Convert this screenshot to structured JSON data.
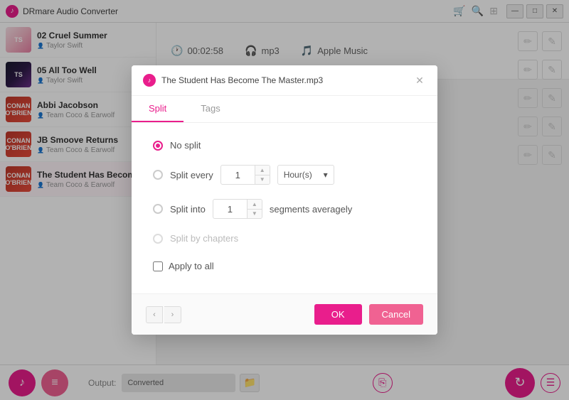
{
  "app": {
    "title": "DRmare Audio Converter",
    "icon": "♪"
  },
  "titlebar": {
    "toolbar_icons": [
      "🛒",
      "🔍",
      "⊞",
      "—",
      "□",
      "✕"
    ],
    "action_icons_wand": "✏",
    "action_icons_edit": "✎"
  },
  "tracks": [
    {
      "id": 1,
      "name": "02 Cruel Summer",
      "artist": "Taylor Swift",
      "thumb_class": "thumb-swift",
      "thumb_text": "TS"
    },
    {
      "id": 2,
      "name": "05 All Too Well",
      "artist": "Taylor Swift",
      "thumb_class": "thumb-swift2",
      "thumb_text": "TS"
    },
    {
      "id": 3,
      "name": "Abbi Jacobson",
      "artist": "Team Coco & Earwolf",
      "thumb_class": "thumb-conan1",
      "thumb_text": "OB"
    },
    {
      "id": 4,
      "name": "JB Smoove Returns",
      "artist": "Team Coco & Earwolf",
      "thumb_class": "thumb-conan2",
      "thumb_text": "OB"
    },
    {
      "id": 5,
      "name": "The Student Has Become",
      "artist": "Team Coco & Earwolf",
      "thumb_class": "thumb-conan3",
      "thumb_text": "OB",
      "active": true
    }
  ],
  "header": {
    "duration": "00:02:58",
    "format": "mp3",
    "source": "Apple Music"
  },
  "modal": {
    "title": "The Student Has Become The Master.mp3",
    "tabs": [
      "Split",
      "Tags"
    ],
    "active_tab": "Split",
    "options": {
      "no_split": "No split",
      "split_every": "Split every",
      "split_into": "Split into",
      "split_by_chapters": "Split by chapters",
      "apply_to_all": "Apply to all"
    },
    "split_every_value": "1",
    "split_every_unit": "Hour(s)",
    "split_into_value": "1",
    "segments_label": "segments averagely",
    "selected_option": "no_split"
  },
  "modal_footer": {
    "nav_prev": "‹",
    "nav_next": "›",
    "ok": "OK",
    "cancel": "Cancel"
  },
  "bottom": {
    "output_label": "Output:",
    "output_path": "Converted",
    "add_music_icon": "♪+",
    "add_list_icon": "≡+"
  }
}
